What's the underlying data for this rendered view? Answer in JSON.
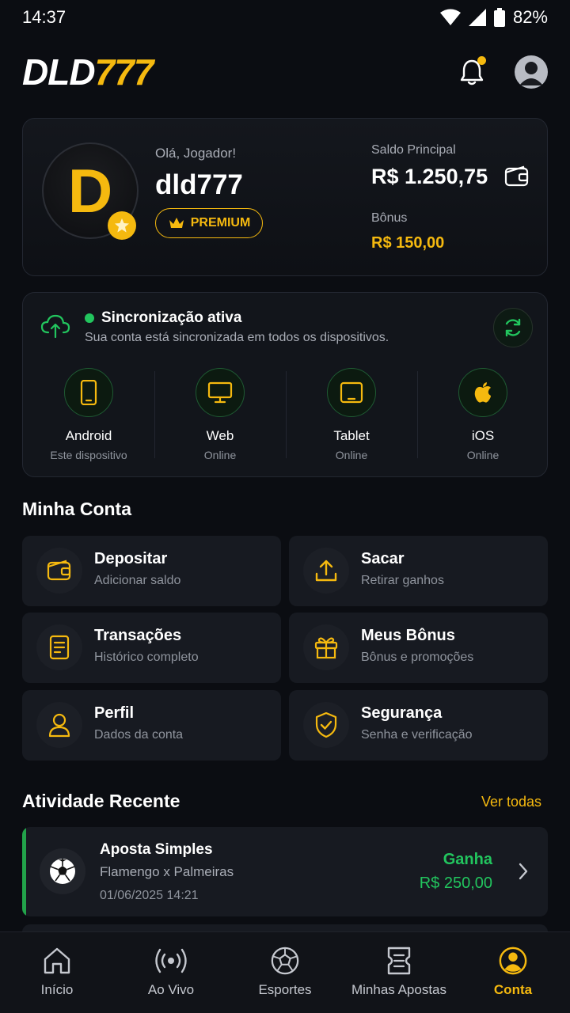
{
  "status_bar": {
    "time": "14:37",
    "battery": "82%"
  },
  "header": {
    "logo_white": "DLD",
    "logo_gold": "777"
  },
  "profile": {
    "avatar_letter": "D",
    "greeting": "Olá, Jogador!",
    "username": "dld777",
    "badge": "PREMIUM",
    "balance_label": "Saldo Principal",
    "balance_value": "R$ 1.250,75",
    "bonus_label": "Bônus",
    "bonus_value": "R$ 150,00"
  },
  "sync": {
    "title": "Sincronização ativa",
    "subtitle": "Sua conta está sincronizada em todos os dispositivos.",
    "devices": [
      {
        "name": "Android",
        "status": "Este dispositivo",
        "icon": "phone-icon"
      },
      {
        "name": "Web",
        "status": "Online",
        "icon": "monitor-icon"
      },
      {
        "name": "Tablet",
        "status": "Online",
        "icon": "tablet-icon"
      },
      {
        "name": "iOS",
        "status": "Online",
        "icon": "apple-icon"
      }
    ]
  },
  "account": {
    "title": "Minha Conta",
    "tiles": [
      {
        "title": "Depositar",
        "subtitle": "Adicionar saldo",
        "icon": "wallet-icon"
      },
      {
        "title": "Sacar",
        "subtitle": "Retirar ganhos",
        "icon": "upload-icon"
      },
      {
        "title": "Transações",
        "subtitle": "Histórico completo",
        "icon": "document-icon"
      },
      {
        "title": "Meus Bônus",
        "subtitle": "Bônus e promoções",
        "icon": "gift-icon"
      },
      {
        "title": "Perfil",
        "subtitle": "Dados da conta",
        "icon": "user-icon"
      },
      {
        "title": "Segurança",
        "subtitle": "Senha e verificação",
        "icon": "shield-icon"
      }
    ]
  },
  "activity": {
    "title": "Atividade Recente",
    "see_all": "Ver todas",
    "items": [
      {
        "title": "Aposta Simples",
        "match": "Flamengo x Palmeiras",
        "date": "01/06/2025 14:21",
        "status": "Ganha",
        "amount": "R$ 250,00"
      }
    ]
  },
  "nav": {
    "items": [
      {
        "label": "Início",
        "icon": "home-icon"
      },
      {
        "label": "Ao Vivo",
        "icon": "live-icon"
      },
      {
        "label": "Esportes",
        "icon": "ball-icon"
      },
      {
        "label": "Minhas Apostas",
        "icon": "ticket-icon"
      },
      {
        "label": "Conta",
        "icon": "account-icon"
      }
    ]
  },
  "colors": {
    "accent": "#f5b90f",
    "success": "#22c55e",
    "background": "#0b0d12",
    "card": "#171a21"
  }
}
